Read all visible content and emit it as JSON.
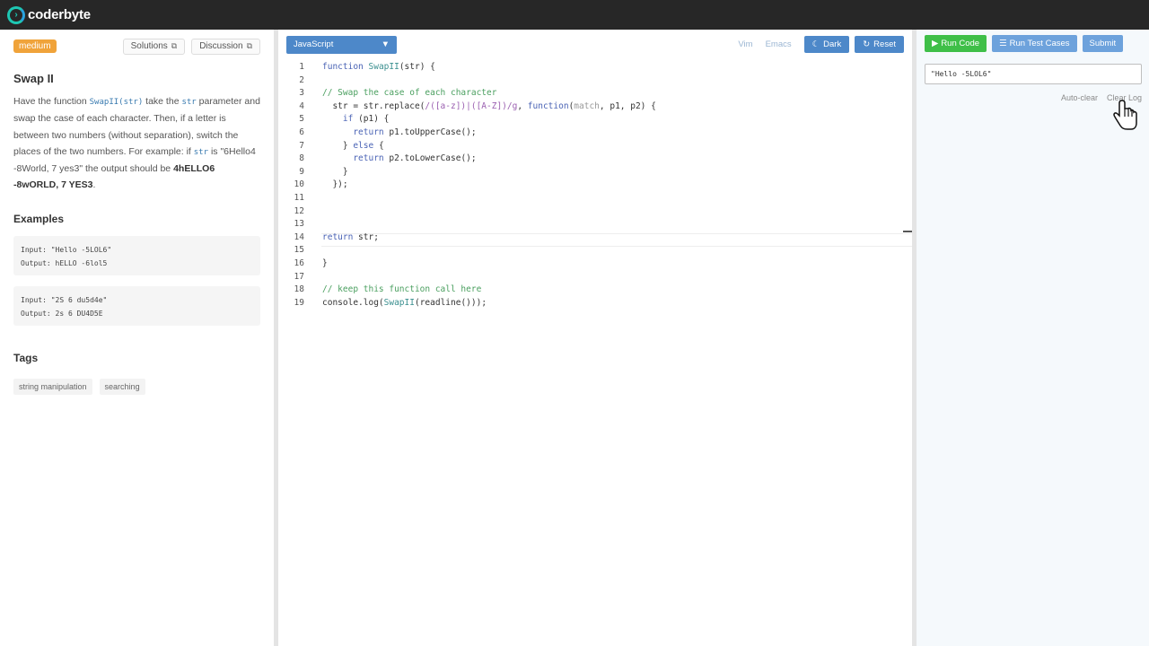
{
  "app": {
    "name": "coderbyte"
  },
  "problem": {
    "difficulty": "medium",
    "solutions_label": "Solutions",
    "discussion_label": "Discussion",
    "title": "Swap II",
    "desc_1": "Have the function",
    "desc_fn": "SwapII(str)",
    "desc_2": "take the",
    "desc_str": "str",
    "desc_3": "parameter and swap the case of each character. Then, if a letter is between two numbers (without separation), switch the places of the two numbers. For example: if",
    "desc_str2": "str",
    "desc_4": "is \"6Hello4 -8World, 7 yes3\" the output should be",
    "desc_out": "4hELLO6 -8wORLD, 7 YES3",
    "desc_end": ".",
    "examples_title": "Examples",
    "examples": [
      {
        "input": "Input: \"Hello -5LOL6\"",
        "output": "Output: hELLO -6lol5"
      },
      {
        "input": "Input: \"2S 6 du5d4e\"",
        "output": "Output: 2s 6 DU4D5E"
      }
    ],
    "tags_title": "Tags",
    "tags": [
      "string manipulation",
      "searching"
    ]
  },
  "editor": {
    "language": "JavaScript",
    "vim": "Vim",
    "emacs": "Emacs",
    "dark": "Dark",
    "reset": "Reset",
    "lines": [
      "1",
      "2",
      "3",
      "4",
      "5",
      "6",
      "7",
      "8",
      "9",
      "10",
      "11",
      "12",
      "13",
      "14",
      "15",
      "16",
      "17",
      "18",
      "19"
    ]
  },
  "runner": {
    "run_code": "Run Code",
    "run_tests": "Run Test Cases",
    "submit": "Submit",
    "input_value": "\"Hello -5LOL6\"",
    "auto_clear": "Auto-clear",
    "clear_log": "Clear Log"
  },
  "colors": {
    "accent": "#4d88c9",
    "run": "#3fbf48",
    "badge": "#f0a33a"
  }
}
